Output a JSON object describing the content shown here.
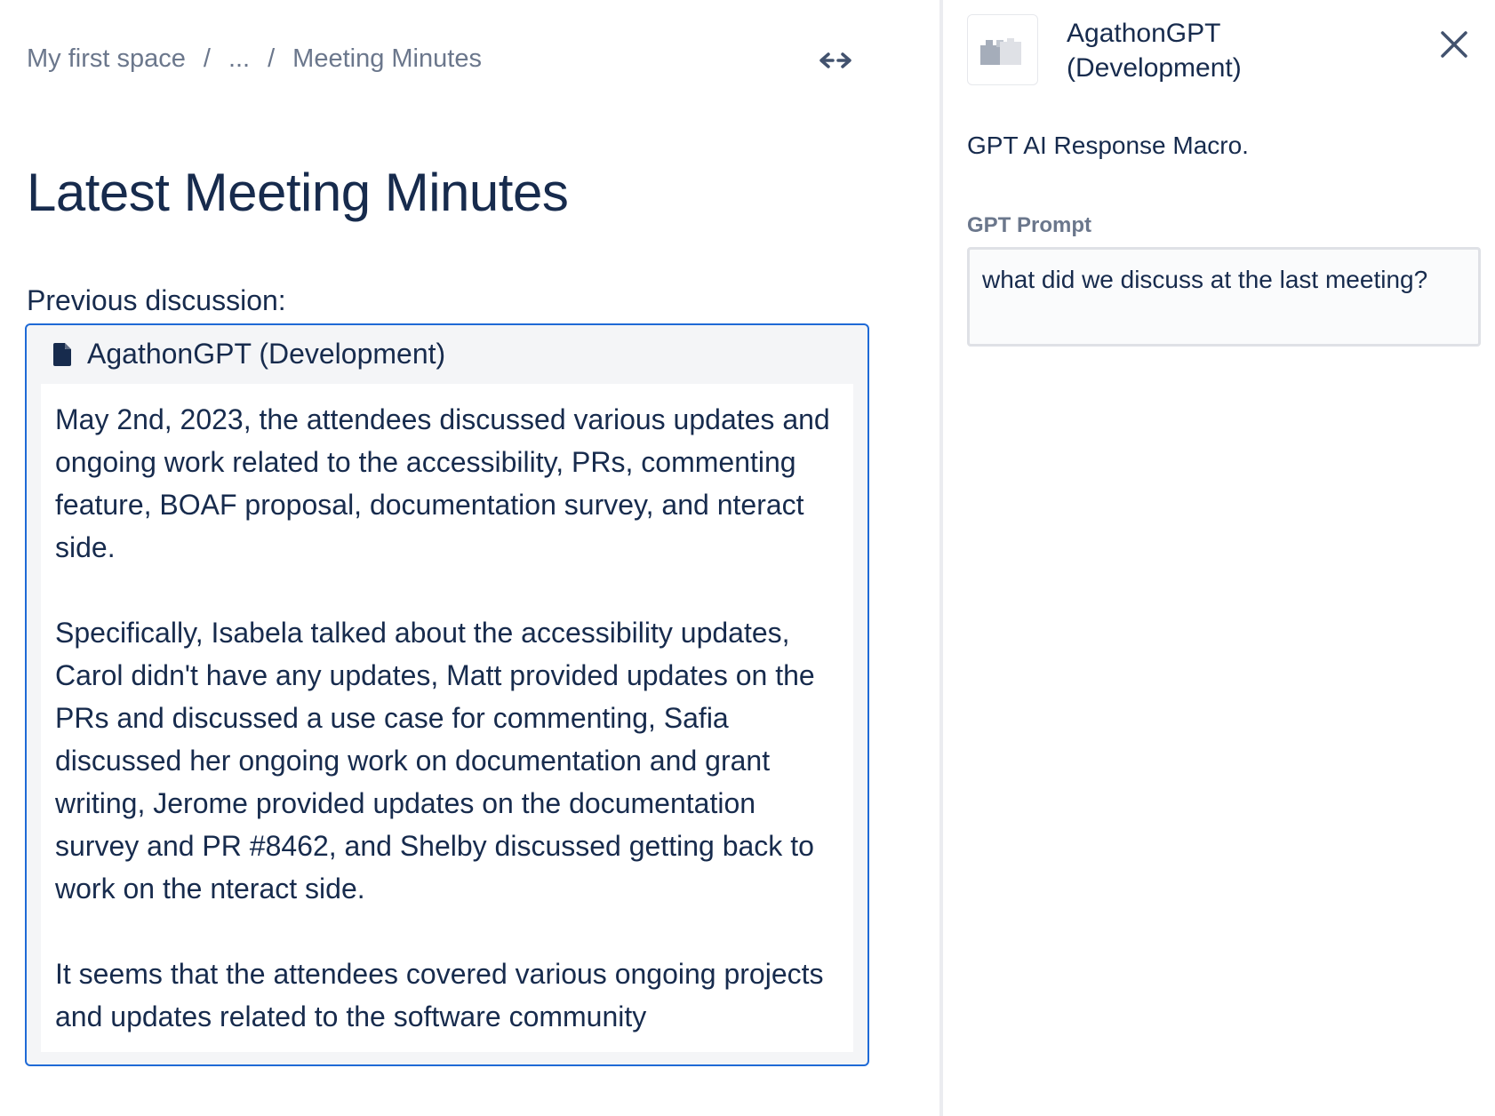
{
  "breadcrumb": {
    "items": [
      "My first space",
      "...",
      "Meeting Minutes"
    ],
    "separator": "/"
  },
  "editor": {
    "expand_icon": "expand-width-icon",
    "title": "Latest Meeting Minutes",
    "previous_label": "Previous discussion:",
    "macro": {
      "icon": "file-icon",
      "name": "AgathonGPT (Development)",
      "paragraphs": [
        "May 2nd, 2023, the attendees discussed various updates and ongoing work related to the accessibility, PRs, commenting feature, BOAF proposal, documentation survey, and nteract side.",
        "Specifically, Isabela talked about the accessibility updates, Carol didn't have any updates, Matt provided updates on the PRs and discussed a use case for commenting, Safia discussed her ongoing work on documentation and grant writing, Jerome provided updates on the documentation survey and PR #8462, and Shelby discussed getting back to work on the nteract side.",
        "It seems that the attendees covered various ongoing projects and updates related to the software community"
      ]
    }
  },
  "panel": {
    "app_logo_icon": "app-logo-icon",
    "app_name_line1": "AgathonGPT",
    "app_name_line2": "(Development)",
    "close_icon": "close-icon",
    "description": "GPT AI Response Macro.",
    "prompt_label": "GPT Prompt",
    "prompt_value": "what did we discuss at the last meeting?"
  },
  "colors": {
    "text_primary": "#172b4d",
    "text_subtle": "#6b778c",
    "macro_border": "#1f6ad6",
    "macro_bg": "#f4f5f7",
    "field_border": "#dfe1e6",
    "field_bg": "#fafbfc"
  }
}
